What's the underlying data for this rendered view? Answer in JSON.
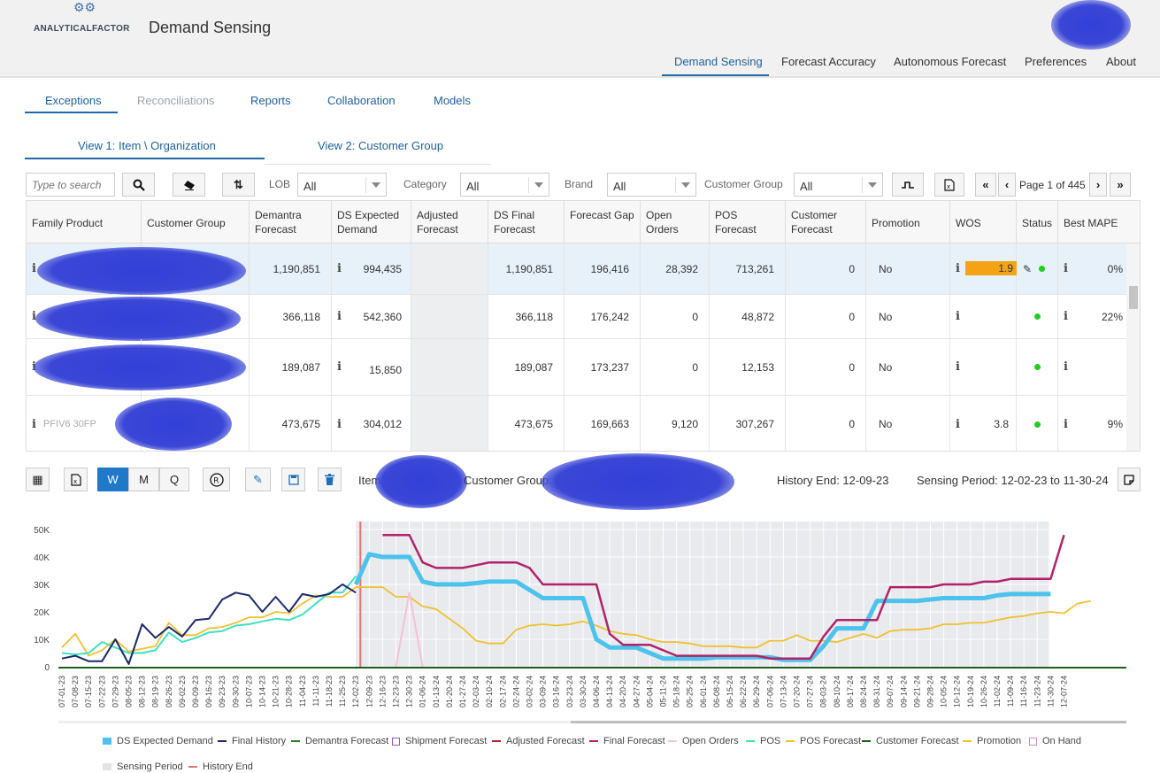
{
  "brand": {
    "logo_text": "ANALYTICALFACTOR",
    "app_title": "Demand Sensing"
  },
  "topnav": [
    "Demand Sensing",
    "Forecast Accuracy",
    "Autonomous Forecast",
    "Preferences",
    "About"
  ],
  "subnav": [
    "Exceptions",
    "Reconciliations",
    "Reports",
    "Collaboration",
    "Models"
  ],
  "views": [
    "View 1: Item \\ Organization",
    "View 2: Customer Group"
  ],
  "toolbar": {
    "search_placeholder": "Type to search",
    "lob_label": "LOB",
    "lob_value": "All",
    "category_label": "Category",
    "category_value": "All",
    "brand_label": "Brand",
    "brand_value": "All",
    "customer_group_label": "Customer Group",
    "customer_group_value": "All",
    "page_text": "Page 1 of 445"
  },
  "table": {
    "headers": [
      "Family Product",
      "Customer Group",
      "Demantra Forecast",
      "DS Expected Demand",
      "Adjusted Forecast",
      "DS Final Forecast",
      "Forecast Gap",
      "Open Orders",
      "POS Forecast",
      "Customer Forecast",
      "Promotion",
      "WOS",
      "Status",
      "Best MAPE"
    ],
    "rows": [
      {
        "demantra": "1,190,851",
        "ds_expected": "994,435",
        "ds_final": "1,190,851",
        "gap": "196,416",
        "open_orders": "28,392",
        "pos": "713,261",
        "customer": "0",
        "promotion": "No",
        "wos": "1.9",
        "mape": "0%"
      },
      {
        "demantra": "366,118",
        "ds_expected": "542,360",
        "ds_final": "366,118",
        "gap": "176,242",
        "open_orders": "0",
        "pos": "48,872",
        "customer": "0",
        "promotion": "No",
        "wos": "",
        "mape": "22%"
      },
      {
        "demantra": "189,087",
        "ds_expected": "15,850",
        "ds_final": "189,087",
        "gap": "173,237",
        "open_orders": "0",
        "pos": "12,153",
        "customer": "0",
        "promotion": "No",
        "wos": "",
        "mape": ""
      },
      {
        "demantra": "473,675",
        "ds_expected": "304,012",
        "ds_final": "473,675",
        "gap": "169,663",
        "open_orders": "9,120",
        "pos": "307,267",
        "customer": "0",
        "promotion": "No",
        "wos": "3.8",
        "mape": "9%"
      }
    ],
    "row4_partial": "PFIV6 30FP"
  },
  "detail_bar": {
    "w": "W",
    "m": "M",
    "q": "Q",
    "item_label": "Item:",
    "customer_group_label": "Customer Group: V",
    "history_end": "History End: 12-09-23",
    "sensing_period": "Sensing Period: 12-02-23 to 11-30-24"
  },
  "colors": {
    "ds_expected": "#4cc3ec",
    "final_history": "#1a2a6c",
    "demantra": "#2e7d32",
    "shipment": "#9b59b6",
    "adjusted": "#a52a2a",
    "final_forecast": "#b0236a",
    "open_orders": "#f6c1d4",
    "pos": "#3ee0c0",
    "pos_forecast": "#f0c030",
    "customer_forecast": "#1e5e1e",
    "promotion": "#f0c030",
    "on_hand": "#c98bd0",
    "sensing": "#e8eaed",
    "history_end": "#e57373"
  },
  "chart_data": {
    "type": "line",
    "yticks": [
      "50K",
      "40K",
      "30K",
      "20K",
      "10K",
      "0"
    ],
    "ylim": [
      0,
      55000
    ],
    "history_end_label": "History End",
    "sensing_period_label": "Sensing Period",
    "x": [
      "07-01-23",
      "07-08-23",
      "07-15-23",
      "07-22-23",
      "07-29-23",
      "08-05-23",
      "08-12-23",
      "08-19-23",
      "08-26-23",
      "09-02-23",
      "09-09-23",
      "09-16-23",
      "09-23-23",
      "09-30-23",
      "10-07-23",
      "10-14-23",
      "10-21-23",
      "10-28-23",
      "11-04-23",
      "11-11-23",
      "11-18-23",
      "11-25-23",
      "12-02-23",
      "12-09-23",
      "12-16-23",
      "12-23-23",
      "12-30-23",
      "01-06-24",
      "01-13-24",
      "01-20-24",
      "01-27-24",
      "02-03-24",
      "02-10-24",
      "02-17-24",
      "02-24-24",
      "03-02-24",
      "03-09-24",
      "03-16-24",
      "03-23-24",
      "03-30-24",
      "04-06-24",
      "04-13-24",
      "04-20-24",
      "04-27-24",
      "05-04-24",
      "05-11-24",
      "05-18-24",
      "05-25-24",
      "06-01-24",
      "06-08-24",
      "06-15-24",
      "06-22-24",
      "06-29-24",
      "07-06-24",
      "07-13-24",
      "07-20-24",
      "07-27-24",
      "08-03-24",
      "08-10-24",
      "08-17-24",
      "08-24-24",
      "08-31-24",
      "09-07-24",
      "09-14-24",
      "09-21-24",
      "09-28-24",
      "10-05-24",
      "10-12-24",
      "10-19-24",
      "10-26-24",
      "11-02-24",
      "11-09-24",
      "11-16-24",
      "11-23-24",
      "11-30-24",
      "12-07-24"
    ],
    "series": [
      {
        "name": "DS Expected Demand",
        "start": 22,
        "values": [
          30000,
          41000,
          40000,
          40000,
          40000,
          31000,
          30000,
          30000,
          30000,
          30500,
          31000,
          31000,
          31000,
          28000,
          25000,
          25000,
          25000,
          25000,
          10000,
          7000,
          7000,
          7000,
          5000,
          3000,
          3000,
          3000,
          3000,
          3500,
          3500,
          3500,
          3500,
          3500,
          2500,
          2500,
          2500,
          7500,
          14000,
          14000,
          14000,
          24000,
          24000,
          24000,
          24000,
          24500,
          25000,
          25000,
          25000,
          25000,
          26000,
          26500,
          26500,
          26500,
          26500
        ]
      },
      {
        "name": "Final History",
        "start": 0,
        "values": [
          3000,
          4000,
          2000,
          2000,
          10000,
          1000,
          15500,
          10500,
          14500,
          11000,
          17000,
          17500,
          24500,
          27000,
          26000,
          20000,
          25500,
          20000,
          26500,
          25500,
          26500,
          30000,
          27000
        ]
      },
      {
        "name": "Final Forecast",
        "start": 24,
        "values": [
          48000,
          48000,
          48000,
          38000,
          36000,
          36000,
          36000,
          37000,
          38000,
          38000,
          38000,
          36000,
          30000,
          30000,
          30000,
          30000,
          30000,
          12000,
          8000,
          8000,
          8000,
          6000,
          4000,
          4000,
          4000,
          4000,
          4000,
          4000,
          4000,
          3000,
          3000,
          3000,
          3000,
          11000,
          17000,
          17000,
          17000,
          17000,
          29000,
          29000,
          29000,
          29000,
          30000,
          30000,
          30000,
          31000,
          31000,
          32000,
          32000,
          32000,
          32000,
          48000
        ]
      },
      {
        "name": "POS",
        "start": 0,
        "values": [
          5000,
          4500,
          5000,
          9000,
          7000,
          5000,
          5000,
          6000,
          12500,
          9000,
          10500,
          12500,
          13000,
          15000,
          15500,
          16500,
          17500,
          17000,
          19000,
          23000,
          27000,
          27000,
          33000
        ]
      },
      {
        "name": "POS Forecast",
        "start": 0,
        "values": [
          7000,
          12000,
          4000,
          6000,
          10000,
          5500,
          6500,
          7500,
          16000,
          11500,
          11500,
          14000,
          14500,
          16000,
          18000,
          18000,
          20000,
          19500,
          23000,
          26000,
          25500,
          25500,
          29000,
          29000,
          29000,
          25500,
          25500,
          22000,
          21000,
          17500,
          14000,
          9500,
          8500,
          8500,
          13500,
          15000,
          15500,
          15000,
          15500,
          16500,
          15000,
          13000,
          12000,
          11500,
          10000,
          9000,
          9000,
          8500,
          7500,
          7500,
          7500,
          7000,
          7000,
          9500,
          9500,
          11500,
          9500,
          9500,
          9000,
          10500,
          12000,
          10500,
          13000,
          13500,
          13500,
          14000,
          15500,
          15500,
          16000,
          16000,
          17000,
          18000,
          18500,
          19500,
          20000,
          19500,
          23000,
          24000
        ]
      },
      {
        "name": "Open Orders",
        "start": 25,
        "values": [
          0,
          27000,
          0
        ]
      }
    ]
  },
  "legend": [
    "DS Expected Demand",
    "Final History",
    "Demantra Forecast",
    "Shipment Forecast",
    "Adjusted Forecast",
    "Final Forecast",
    "Open Orders",
    "POS",
    "POS Forecast",
    "Customer Forecast",
    "Promotion",
    "On Hand",
    "Sensing Period",
    "History End"
  ]
}
